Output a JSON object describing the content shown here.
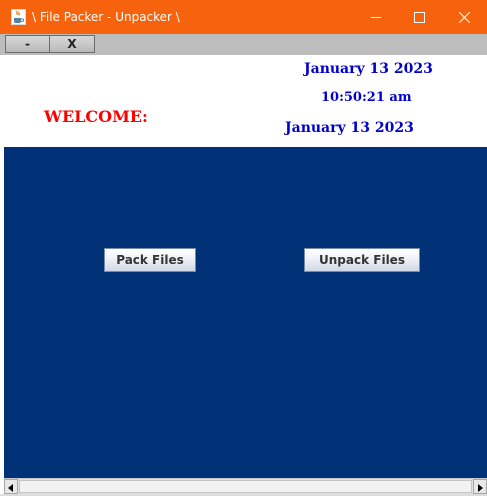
{
  "window": {
    "title": "\\ File Packer - Unpacker \\",
    "app_icon": "java-coffee-cup-icon",
    "controls": {
      "minimize_icon": "minimize-icon",
      "maximize_icon": "maximize-icon",
      "close_icon": "close-icon"
    },
    "titlebar_color": "#f7630c"
  },
  "toolbar": {
    "minimize_label": "-",
    "exit_label": "X"
  },
  "header": {
    "date_top": "January 13 2023",
    "clock": "10:50:21 am",
    "welcome": "WELCOME:",
    "date_bottom": "January 13 2023",
    "date_color": "#0000cc",
    "welcome_color": "#ff0000"
  },
  "main": {
    "background_color": "#003075",
    "pack_label": "Pack Files",
    "unpack_label": "Unpack Files"
  },
  "scrollbar": {
    "left_icon": "arrow-left-icon",
    "right_icon": "arrow-right-icon"
  }
}
